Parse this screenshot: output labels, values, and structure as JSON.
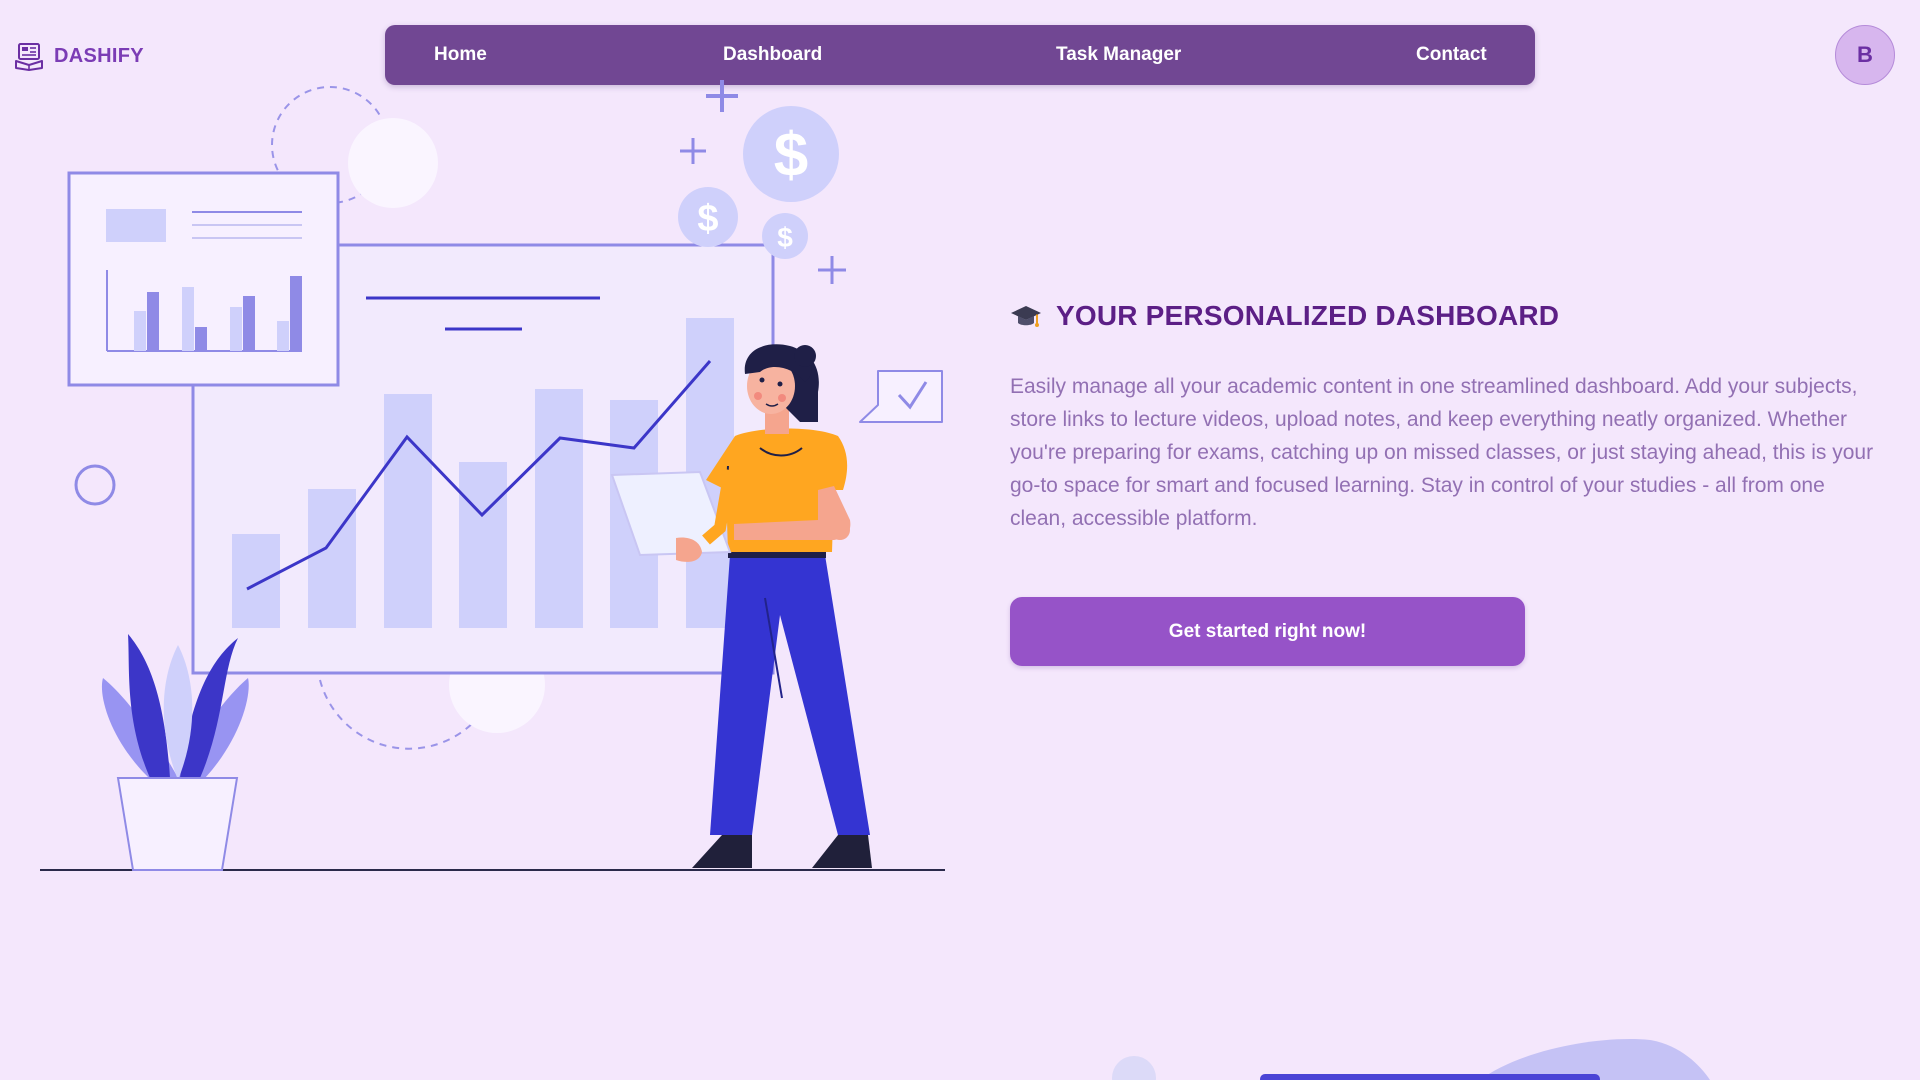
{
  "brand": {
    "name": "DASHIFY",
    "icon": "book-laptop-icon",
    "color": "#7b3cb5"
  },
  "nav": {
    "items": [
      {
        "label": "Home"
      },
      {
        "label": "Dashboard"
      },
      {
        "label": "Task Manager"
      },
      {
        "label": "Contact"
      }
    ],
    "background": "#714793"
  },
  "user": {
    "avatar_initial": "B"
  },
  "hero": {
    "icon": "graduation-cap-icon",
    "title": "YOUR PERSONALIZED DASHBOARD",
    "description": "Easily manage all your academic content in one streamlined dashboard. Add your subjects, store links to lecture videos, upload notes, and keep everything neatly organized. Whether you're preparing for exams, catching up on missed classes, or just staying ahead, this is your go-to space for smart and focused learning. Stay in control of your studies - all from one clean, accessible platform.",
    "cta_label": "Get started right now!",
    "cta_color": "#9653c8"
  },
  "illustration": {
    "description_icon": "analytics-presentation-illustration"
  },
  "colors": {
    "page_bg": "#f4e7fc",
    "accent": "#5c1f86"
  }
}
